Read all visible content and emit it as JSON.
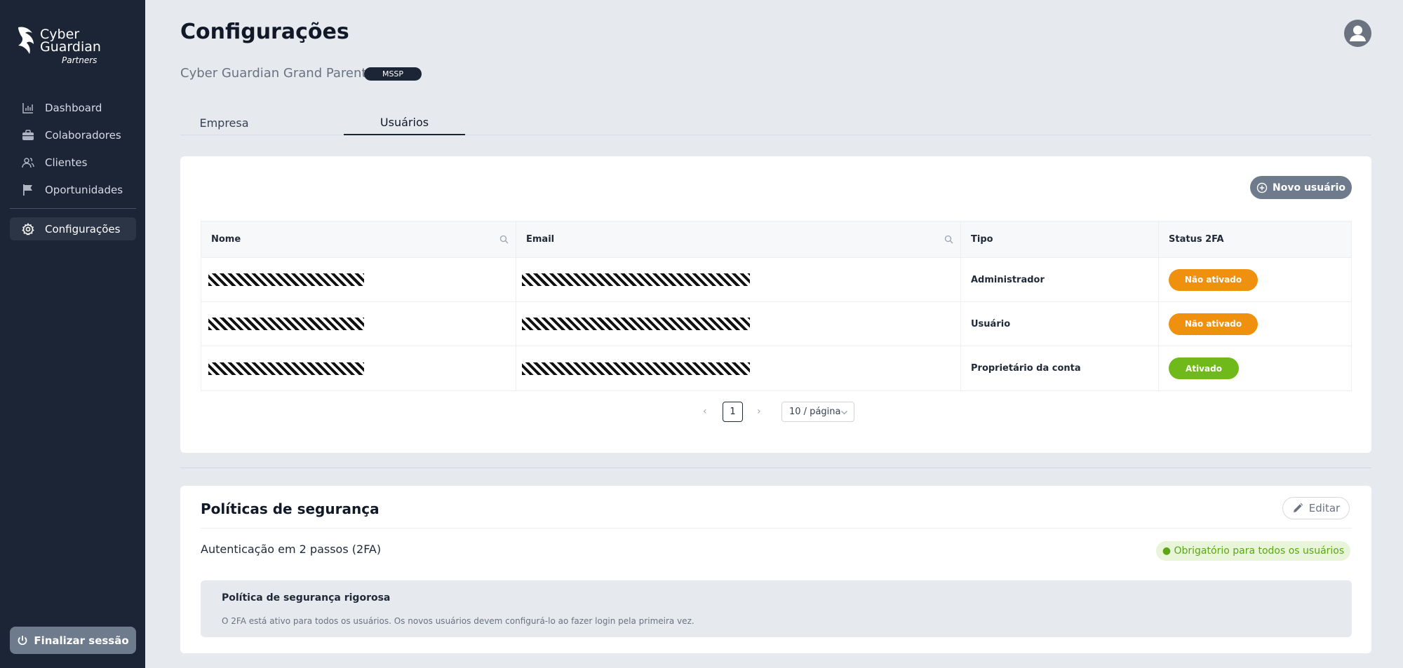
{
  "colors": {
    "sidebar_bg": "#1c2536",
    "page_bg": "#e6e9ee",
    "status_off": "#f0900f",
    "status_on": "#6fba1a"
  },
  "brand": {
    "line1": "Cyber",
    "line2": "Guardian",
    "line3": "Partners",
    "icon": "eagle-logo-icon"
  },
  "sidebar": {
    "items": [
      {
        "label": "Dashboard",
        "icon": "bar-chart-icon"
      },
      {
        "label": "Colaboradores",
        "icon": "briefcase-icon"
      },
      {
        "label": "Clientes",
        "icon": "users-icon"
      },
      {
        "label": "Oportunidades",
        "icon": "flag-icon"
      }
    ],
    "active_item": {
      "label": "Configurações",
      "icon": "gear-icon"
    },
    "logout_label": "Finalizar sessão"
  },
  "header": {
    "title": "Configurações",
    "company": "Cyber Guardian Grand Parent",
    "badge": "MSSP"
  },
  "tabs": [
    {
      "label": "Empresa",
      "active": false
    },
    {
      "label": "Usuários",
      "active": true
    }
  ],
  "users": {
    "new_button": "Novo usuário",
    "columns": [
      "Nome",
      "Email",
      "Tipo",
      "Status 2FA"
    ],
    "rows": [
      {
        "tipo": "Administrador",
        "status": "Não ativado",
        "active": false
      },
      {
        "tipo": "Usuário",
        "status": "Não ativado",
        "active": false
      },
      {
        "tipo": "Proprietário da conta",
        "status": "Ativado",
        "active": true
      }
    ],
    "pagination": {
      "current": "1",
      "page_size": "10 / página"
    }
  },
  "policies": {
    "title": "Políticas de segurança",
    "edit_label": "Editar",
    "twofa_label": "Autenticação em 2 passos (2FA)",
    "twofa_status": "● Obrigatório para todos os usuários",
    "box_title": "Política de segurança rigorosa",
    "box_text": "O 2FA está ativo para todos os usuários. Os novos usuários devem configurá-lo ao fazer login pela primeira vez."
  }
}
